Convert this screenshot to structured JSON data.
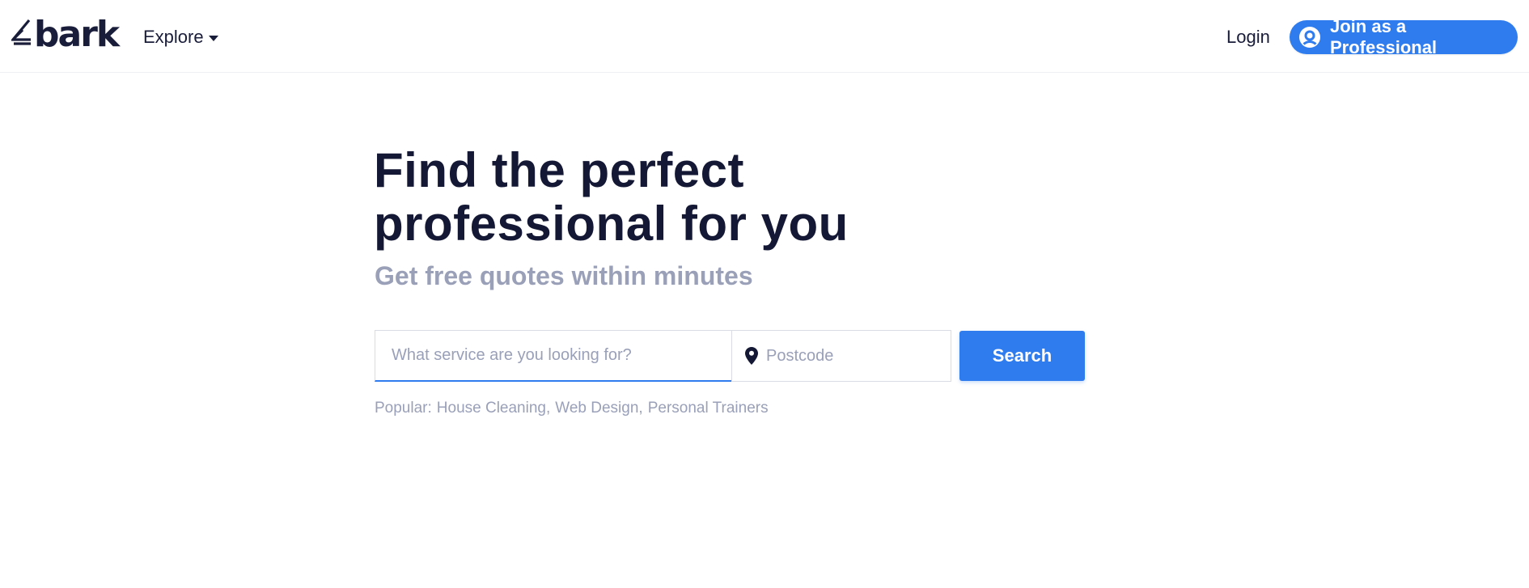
{
  "brand": {
    "name": "bark",
    "color": "#1a1d3a",
    "accent": "#2f7cef",
    "muted_text": "#9aa0b8"
  },
  "header": {
    "explore_label": "Explore",
    "login_label": "Login",
    "join_label": "Join as a Professional",
    "icons": {
      "explore_caret": "caret-down-icon",
      "join": "user-circle-icon"
    }
  },
  "hero": {
    "headline_line1": "Find the perfect",
    "headline_line2": "professional for you",
    "subhead": "Get free quotes within minutes"
  },
  "search": {
    "service_placeholder": "What service are you looking for?",
    "service_value": "",
    "postcode_placeholder": "Postcode",
    "postcode_value": "",
    "postcode_icon": "map-pin-icon",
    "button_label": "Search"
  },
  "popular": {
    "label": "Popular:",
    "items": [
      "House Cleaning",
      "Web Design",
      "Personal Trainers"
    ]
  }
}
